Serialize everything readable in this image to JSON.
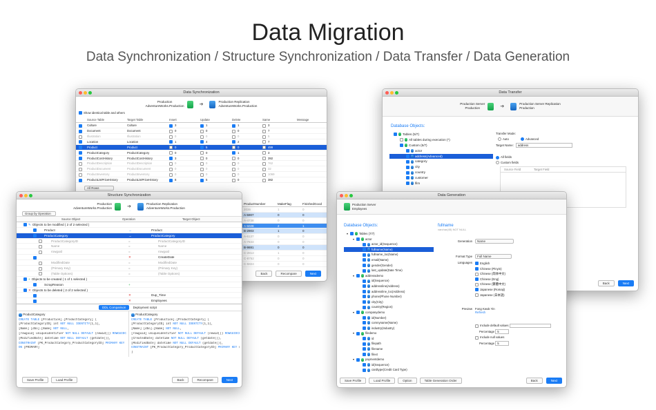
{
  "headline": "Data Migration",
  "subheadline": "Data Synchronization / Structure Synchronization / Data Transfer / Data Generation",
  "data_sync": {
    "title": "Data Synchronization",
    "source_label": "Production",
    "source_db": "AdventureWorks.Production",
    "target_label": "Production Replication",
    "target_db": "AdventureWorks.Production",
    "show_identical": "Show identical table and others",
    "columns": [
      "Source Table",
      "Target Table",
      "Insert",
      "Update",
      "Delete",
      "Same",
      "Message"
    ],
    "rows": [
      {
        "src": "Culture",
        "tgt": "Culture",
        "ins": "3",
        "upd": "1",
        "del": "1",
        "same": "3",
        "state": "on"
      },
      {
        "src": "Document",
        "tgt": "Document",
        "ins": "0",
        "upd": "0",
        "del": "0",
        "same": "7",
        "state": "on"
      },
      {
        "src": "Illustration",
        "tgt": "Illustration",
        "ins": "0",
        "upd": "0",
        "del": "0",
        "same": "5",
        "state": "dim"
      },
      {
        "src": "Location",
        "tgt": "Location",
        "ins": "1",
        "upd": "4",
        "del": "2",
        "same": "7",
        "state": "on"
      },
      {
        "src": "Product",
        "tgt": "Product",
        "ins": "0",
        "upd": "5",
        "del": "0",
        "same": "499",
        "state": "sel"
      },
      {
        "src": "ProductCategory",
        "tgt": "ProductCategory",
        "ins": "0",
        "upd": "0",
        "del": "1",
        "same": "3",
        "state": "on"
      },
      {
        "src": "ProductCostHistory",
        "tgt": "ProductCostHistory",
        "ins": "3",
        "upd": "0",
        "del": "0",
        "same": "392",
        "state": "on"
      },
      {
        "src": "ProductDescription",
        "tgt": "ProductDescription",
        "ins": "0",
        "upd": "0",
        "del": "0",
        "same": "762",
        "state": "dim"
      },
      {
        "src": "ProductDocument",
        "tgt": "ProductDocument",
        "ins": "0",
        "upd": "0",
        "del": "0",
        "same": "32",
        "state": "dim"
      },
      {
        "src": "ProductInventory",
        "tgt": "ProductInventory",
        "ins": "0",
        "upd": "0",
        "del": "0",
        "same": "1069",
        "state": "dim"
      },
      {
        "src": "ProductListPriceHistory",
        "tgt": "ProductListPriceHistory",
        "ins": "8",
        "upd": "5",
        "del": "0",
        "same": "382",
        "state": "on"
      }
    ],
    "filter": "All Rows",
    "grid_cols": [
      "ProductNumber",
      "MakeFlag",
      "FinishedGood"
    ],
    "grid_rows": [
      {
        "pn": "2036",
        "mf": "1",
        "fg": "0",
        "hl": ""
      },
      {
        "pn": "A-5907",
        "mf": "0",
        "fg": "0",
        "hl": "a"
      },
      {
        "pn": "A-4738",
        "mf": "0",
        "fg": "0",
        "hl": ""
      },
      {
        "pn": "A-5028",
        "mf": "2",
        "fg": "1",
        "hl": "b"
      },
      {
        "pn": "B-2903",
        "mf": "1",
        "fg": "0",
        "hl": "a"
      },
      {
        "pn": "A-6137",
        "mf": "0",
        "fg": "0",
        "hl": ""
      },
      {
        "pn": "A-7833",
        "mf": "0",
        "fg": "0",
        "hl": ""
      },
      {
        "pn": "B-9881",
        "mf": "0",
        "fg": "0",
        "hl": "a"
      },
      {
        "pn": "C-2812",
        "mf": "1",
        "fg": "0",
        "hl": ""
      },
      {
        "pn": "C-8752",
        "mf": "0",
        "fg": "0",
        "hl": ""
      },
      {
        "pn": "C-5824",
        "mf": "0",
        "fg": "0",
        "hl": ""
      }
    ],
    "back": "Back",
    "recompare": "Recompare",
    "next": "Next"
  },
  "structure_sync": {
    "title": "Structure Synchronization",
    "group_by": "Group by Operation",
    "source_label": "Production",
    "source_db": "AdventureWorks.Production",
    "target_label": "Production Replication",
    "target_db": "AdventureWorks.Production",
    "columns": [
      "Source Object",
      "Operation",
      "Target Object"
    ],
    "modify_group": "Objects to be modified ( 2 of 2 selected )",
    "create_group": "Objects to be created ( 1 of 1 selected )",
    "delete_group": "Objects to be deleted ( 2 of 2 selected )",
    "modify_rows": [
      {
        "src": "Product",
        "op": "→",
        "tgt": "Product",
        "kind": "table"
      },
      {
        "src": "ProductCategory",
        "op": "→",
        "tgt": "ProductCategory",
        "kind": "sel"
      },
      {
        "src": "ProductCategoryID",
        "op": "=",
        "tgt": "ProductCategoryID",
        "kind": "col"
      },
      {
        "src": "Name",
        "op": "=",
        "tgt": "Name",
        "kind": "col"
      },
      {
        "src": "rowguid",
        "op": "=",
        "tgt": "rowguid",
        "kind": "col"
      },
      {
        "src": "",
        "op": "✕",
        "tgt": "CreateDate",
        "kind": "del"
      },
      {
        "src": "ModifiedDate",
        "op": "=",
        "tgt": "ModifiedDate",
        "kind": "col"
      },
      {
        "src": "(Primary Key)",
        "op": "=",
        "tgt": "(Primary Key)",
        "kind": "col"
      },
      {
        "src": "(Table Options)",
        "op": "=",
        "tgt": "(Table Options)",
        "kind": "col"
      }
    ],
    "create_rows": [
      {
        "src": "ScrapReason",
        "op": "+",
        "tgt": ""
      }
    ],
    "delete_rows": [
      {
        "src": "",
        "op": "✕",
        "tgt": "Dup_Time"
      },
      {
        "src": "",
        "op": "✕",
        "tgt": "Employees"
      }
    ],
    "tab_ddl": "DDL Comparison",
    "tab_deploy": "Deployment script",
    "left_obj": "ProductCategory",
    "right_obj": "ProductCategory",
    "left_code": [
      "CREATE TABLE [Production].[ProductCategory] (",
      "[ProductCategoryID] int NOT NULL IDENTITY(1,1),",
      "[Name] [dbo].[Name] NOT NULL,",
      "[rowguid] uniqueidentifier NOT NULL DEFAULT (newid()) ROWGUIDCOL,",
      "[ModifiedDate] datetime NOT NULL DEFAULT (getdate()),",
      "CONSTRAINT [PK_ProductCategory_ProductCategoryID] PRIMARY KEY (",
      "ON [PRIMARY]"
    ],
    "right_code": [
      "CREATE TABLE [Production].[ProductCategory] (",
      "[ProductCategoryID] int NOT NULL IDENTITY(1,1),",
      "[Name] [dbo].[Name] NOT NULL,",
      "[rowguid] uniqueidentifier NOT NULL DEFAULT (newid()) ROWGUIDCOL,",
      "[CreatedDate] datetime NOT NULL DEFAULT (getdate()),",
      "[ModifiedDate] datetime NOT NULL DEFAULT (getdate()),",
      "CONSTRAINT [PK_ProductCategory_ProductCategoryID] PRIMARY KEY (",
      ")"
    ],
    "save_profile": "Save Profile",
    "load_profile": "Load Profile",
    "back": "Back",
    "recompare": "Recompare",
    "next": "Next"
  },
  "data_transfer": {
    "title": "Data Transfer",
    "source_label": "Production Server",
    "source_db": "Production",
    "target_label": "Production Server Replication",
    "target_db": "Production",
    "db_objects": "Database Objects:",
    "tree": [
      {
        "label": "Tables (5/7)",
        "indent": 0
      },
      {
        "label": "All tables during execution (*)",
        "indent": 1
      },
      {
        "label": "Custom (5/7)",
        "indent": 1
      },
      {
        "label": "actor",
        "indent": 2
      },
      {
        "label": "address(Advanced)",
        "indent": 2,
        "sel": true
      },
      {
        "label": "category",
        "indent": 2
      },
      {
        "label": "city",
        "indent": 2
      },
      {
        "label": "country",
        "indent": 2
      },
      {
        "label": "customer",
        "indent": 2
      },
      {
        "label": "film",
        "indent": 2
      }
    ],
    "transfer_mode": "Transfer Mode:",
    "auto": "Auto",
    "advanced": "Advanced",
    "target_name_label": "Target Name:",
    "target_name": "address",
    "all_fields": "All fields",
    "custom_fields": "Custom fields",
    "source_field": "Source Field",
    "target_field": "Target Field",
    "back": "Back",
    "next": "Next"
  },
  "data_gen": {
    "title": "Data Generation",
    "server": "Production Server",
    "db": "Employees",
    "db_objects": "Database Objects:",
    "field_name": "fullname",
    "field_type": "varchar(45) NOT NULL",
    "generation_label": "Generation",
    "generation": "Name",
    "format_label": "Format Type",
    "format": "Full Name",
    "languages_label": "Languages",
    "languages": [
      {
        "name": "English",
        "on": true
      },
      {
        "name": "Chinese (Pinyin)",
        "on": true
      },
      {
        "name": "Chinese (简体中文)",
        "on": false
      },
      {
        "name": "Chinese (Eng)",
        "on": true
      },
      {
        "name": "Chinese (繁體中文)",
        "on": false
      },
      {
        "name": "Japanese (Romaji)",
        "on": true
      },
      {
        "name": "Japanese (日本語)",
        "on": false
      }
    ],
    "preview_label": "Preview",
    "preview": "Fong Kwok Yin",
    "refresh": "Refresh",
    "include_default": "Include default values",
    "percentage_label": "Percentage",
    "pct1": "5",
    "include_null": "Include null values",
    "pct2": "5",
    "tree": [
      {
        "label": "Tables (7/7)",
        "indent": 0
      },
      {
        "label": "actor",
        "indent": 1
      },
      {
        "label": "actor_id(Sequence)",
        "indent": 2
      },
      {
        "label": "fullname(Name)",
        "indent": 2,
        "sel": true
      },
      {
        "label": "fullname_loc(Name)",
        "indent": 2
      },
      {
        "label": "email(Name)",
        "indent": 2
      },
      {
        "label": "gender(Gender)",
        "indent": 2
      },
      {
        "label": "last_update(Date Time)",
        "indent": 2
      },
      {
        "label": "addressdemo",
        "indent": 1
      },
      {
        "label": "id(Sequence)",
        "indent": 2
      },
      {
        "label": "addressline(Address)",
        "indent": 2
      },
      {
        "label": "addressline_loc(Address)",
        "indent": 2
      },
      {
        "label": "phone(Phone Number)",
        "indent": 2
      },
      {
        "label": "city(City)",
        "indent": 2
      },
      {
        "label": "country(Region)",
        "indent": 2
      },
      {
        "label": "companydemo",
        "indent": 1
      },
      {
        "label": "id(Number)",
        "indent": 2
      },
      {
        "label": "comnyname(Name)",
        "indent": 2
      },
      {
        "label": "industry(Industry)",
        "indent": 2
      },
      {
        "label": "filedemo",
        "indent": 1
      },
      {
        "label": "id",
        "indent": 2
      },
      {
        "label": "filepath",
        "indent": 2
      },
      {
        "label": "filename",
        "indent": 2
      },
      {
        "label": "filext",
        "indent": 2
      },
      {
        "label": "paymentdemo",
        "indent": 1
      },
      {
        "label": "id(Sequence)",
        "indent": 2
      },
      {
        "label": "cardtype(Credit Card Type)",
        "indent": 2
      }
    ],
    "save_profile": "Save Profile",
    "load_profile": "Load Profile",
    "option": "Option",
    "order": "Table Generation Order",
    "back": "Back",
    "next": "Next"
  }
}
